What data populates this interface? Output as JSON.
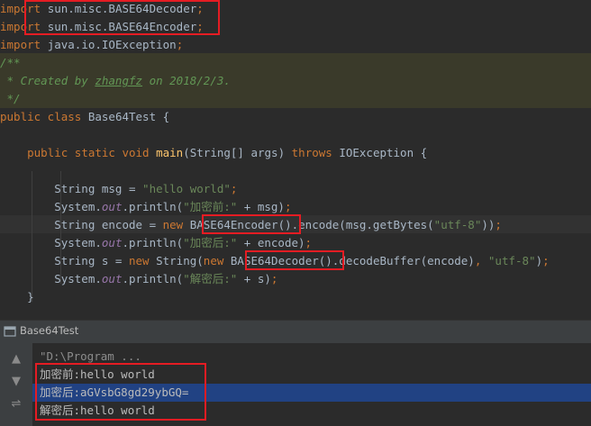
{
  "editor": {
    "lines": [
      {
        "parts": [
          {
            "c": "kw",
            "t": "import "
          },
          {
            "c": "",
            "t": "sun.misc.BASE64Decoder"
          },
          {
            "c": "kw",
            "t": ";"
          }
        ]
      },
      {
        "parts": [
          {
            "c": "kw",
            "t": "import "
          },
          {
            "c": "",
            "t": "sun.misc.BASE64Encoder"
          },
          {
            "c": "kw",
            "t": ";"
          }
        ]
      },
      {
        "parts": [
          {
            "c": "kw",
            "t": "import "
          },
          {
            "c": "",
            "t": "java.io.IOException"
          },
          {
            "c": "kw",
            "t": ";"
          }
        ]
      },
      {
        "parts": [
          {
            "c": "cm",
            "t": "/**"
          }
        ]
      },
      {
        "parts": [
          {
            "c": "cm",
            "t": " * Created by "
          },
          {
            "c": "cmu",
            "t": "zhangfz"
          },
          {
            "c": "cm",
            "t": " on 2018/2/3."
          }
        ]
      },
      {
        "parts": [
          {
            "c": "cm",
            "t": " */"
          }
        ]
      },
      {
        "parts": [
          {
            "c": "kw",
            "t": "public class "
          },
          {
            "c": "",
            "t": "Base64Test {"
          }
        ]
      },
      {
        "parts": []
      },
      {
        "parts": [
          {
            "c": "",
            "t": "    "
          },
          {
            "c": "kw",
            "t": "public static void "
          },
          {
            "c": "fn",
            "t": "main"
          },
          {
            "c": "",
            "t": "(String[] args) "
          },
          {
            "c": "kw",
            "t": "throws "
          },
          {
            "c": "",
            "t": "IOException {"
          }
        ]
      },
      {
        "parts": []
      },
      {
        "parts": [
          {
            "c": "",
            "t": "        String msg = "
          },
          {
            "c": "str",
            "t": "\"hello world\""
          },
          {
            "c": "kw",
            "t": ";"
          }
        ]
      },
      {
        "parts": [
          {
            "c": "",
            "t": "        System."
          },
          {
            "c": "fld",
            "t": "out"
          },
          {
            "c": "",
            "t": ".println("
          },
          {
            "c": "str",
            "t": "\"加密前:\""
          },
          {
            "c": "",
            "t": " + msg)"
          },
          {
            "c": "kw",
            "t": ";"
          }
        ]
      },
      {
        "parts": [
          {
            "c": "",
            "t": "        String encode = "
          },
          {
            "c": "kw",
            "t": "new "
          },
          {
            "c": "",
            "t": "BASE64Encoder().encode(msg.getBytes("
          },
          {
            "c": "str",
            "t": "\"utf-8\""
          },
          {
            "c": "",
            "t": "))"
          },
          {
            "c": "kw",
            "t": ";"
          }
        ]
      },
      {
        "parts": [
          {
            "c": "",
            "t": "        System."
          },
          {
            "c": "fld",
            "t": "out"
          },
          {
            "c": "",
            "t": ".println("
          },
          {
            "c": "str",
            "t": "\"加密后:\""
          },
          {
            "c": "",
            "t": " + encode)"
          },
          {
            "c": "kw",
            "t": ";"
          }
        ]
      },
      {
        "parts": [
          {
            "c": "",
            "t": "        String s = "
          },
          {
            "c": "kw",
            "t": "new "
          },
          {
            "c": "",
            "t": "String("
          },
          {
            "c": "kw",
            "t": "new "
          },
          {
            "c": "",
            "t": "BASE64Decoder().decodeBuffer(encode)"
          },
          {
            "c": "kw",
            "t": ", "
          },
          {
            "c": "str",
            "t": "\"utf-8\""
          },
          {
            "c": "",
            "t": ")"
          },
          {
            "c": "kw",
            "t": ";"
          }
        ]
      },
      {
        "parts": [
          {
            "c": "",
            "t": "        System."
          },
          {
            "c": "fld",
            "t": "out"
          },
          {
            "c": "",
            "t": ".println("
          },
          {
            "c": "str",
            "t": "\"解密后:\""
          },
          {
            "c": "",
            "t": " + s)"
          },
          {
            "c": "kw",
            "t": ";"
          }
        ]
      },
      {
        "parts": [
          {
            "c": "",
            "t": "    }"
          }
        ]
      }
    ]
  },
  "run_panel": {
    "title": "Base64Test",
    "command": "\"D:\\Program ...",
    "output": [
      "加密前:hello world",
      "加密后:aGVsbG8gd29ybGQ=",
      "解密后:hello world"
    ]
  },
  "colors": {
    "keyword": "#cc7832",
    "string": "#6a8759",
    "method": "#ffc66d",
    "comment": "#629755",
    "highlight_box": "#e51c23",
    "selection": "#214283"
  }
}
